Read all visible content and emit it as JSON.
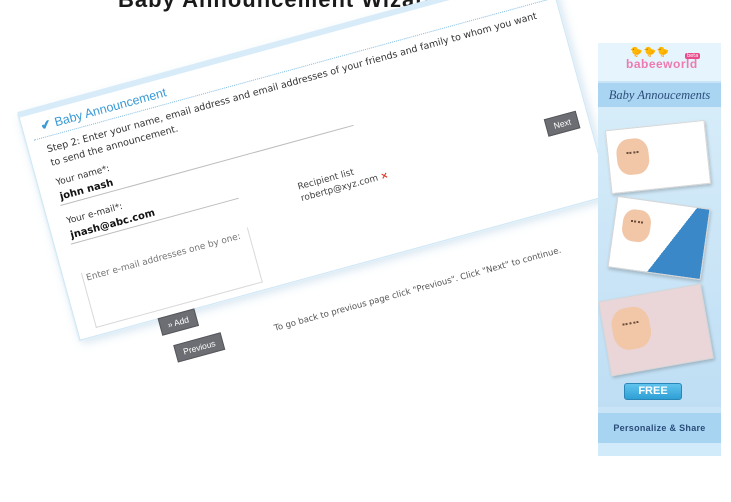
{
  "page": {
    "caption": "Baby Announcement Wizard"
  },
  "form": {
    "title": "Baby Announcement",
    "step_text": "Step 2: Enter your name, email address and email addresses of your friends and family to whom you want to send the announcement.",
    "name_label": "Your name*:",
    "name_value": "john nash",
    "email_label": "Your e-mail*:",
    "email_value": "jnash@abc.com",
    "emails_placeholder": "Enter e-mail addresses one by one:",
    "recipient_label": "Recipient list",
    "recipients": [
      "robertp@xyz.com"
    ],
    "remove_symbol": "×",
    "add_button": "» Add",
    "previous_button": "Previous",
    "next_button": "Next",
    "hint": "To go back to previous page click \"Previous\". Click \"Next\" to continue."
  },
  "ad": {
    "logo_ducks": "🐤🐤🐤",
    "logo_text": "babeeworld",
    "logo_badge": "beta",
    "heading": "Baby Annoucements",
    "free_label": "FREE",
    "share_label": "Personalize & Share"
  },
  "colors": {
    "accent": "#3a9ad6",
    "button": "#6c6e73",
    "remove": "#e0301e"
  }
}
